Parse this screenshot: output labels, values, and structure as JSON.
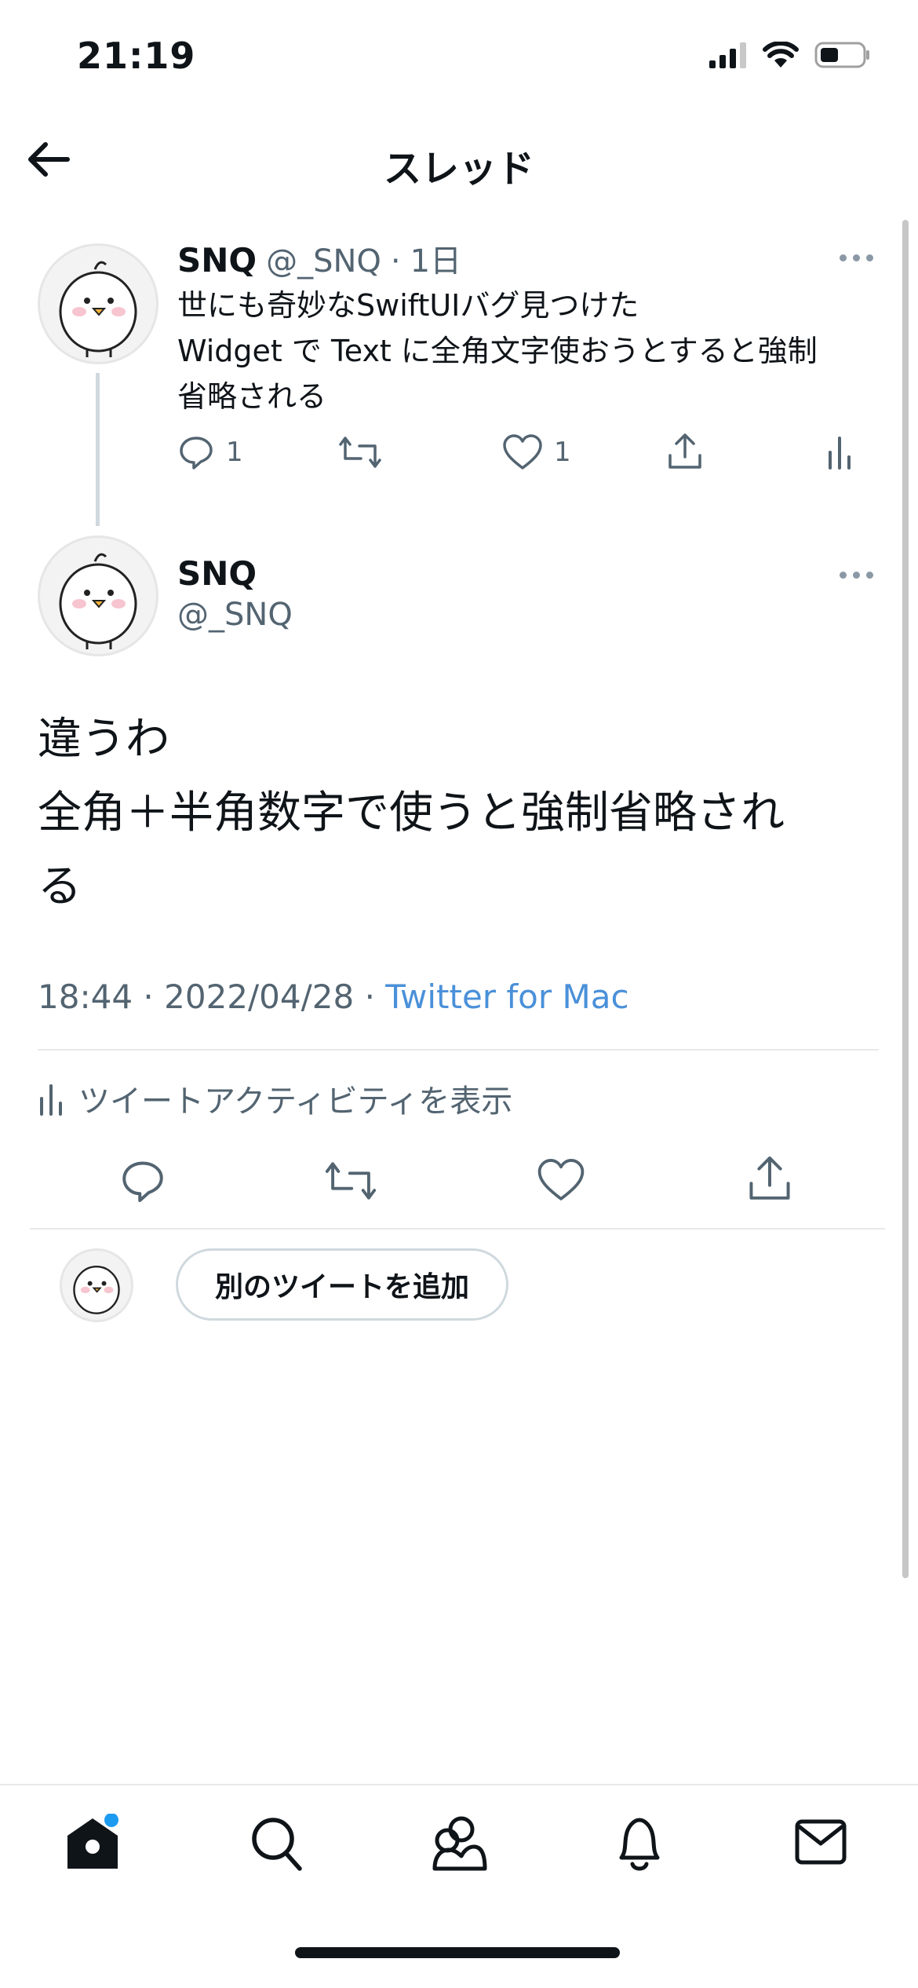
{
  "status_bar": {
    "time": "21:19"
  },
  "header": {
    "title": "スレッド"
  },
  "first_tweet": {
    "name": "SNQ",
    "handle": "@_SNQ",
    "separator": "·",
    "age": "1日",
    "lines": [
      "世にも奇妙なSwiftUIバグ見つけた",
      "Widget で Text に全角文字使おうとすると強制",
      "省略される"
    ],
    "reply_count": "1",
    "like_count": "1"
  },
  "main_tweet": {
    "name": "SNQ",
    "handle": "@_SNQ",
    "lines": [
      "違うわ",
      "全角＋半角数字で使うと強制省略され",
      "る"
    ],
    "time": "18:44",
    "sep1": "·",
    "date": "2022/04/28",
    "sep2": "·",
    "client": "Twitter for Mac",
    "activity_label": "ツイートアクティビティを表示"
  },
  "reply": {
    "button_label": "別のツイートを追加"
  },
  "colors": {
    "accent": "#4a90d9",
    "text": "#0f1419",
    "muted": "#536471",
    "badge": "#1d9bf0"
  },
  "tabs": [
    "home-icon",
    "search-icon",
    "communities-icon",
    "notifications-icon",
    "messages-icon"
  ]
}
